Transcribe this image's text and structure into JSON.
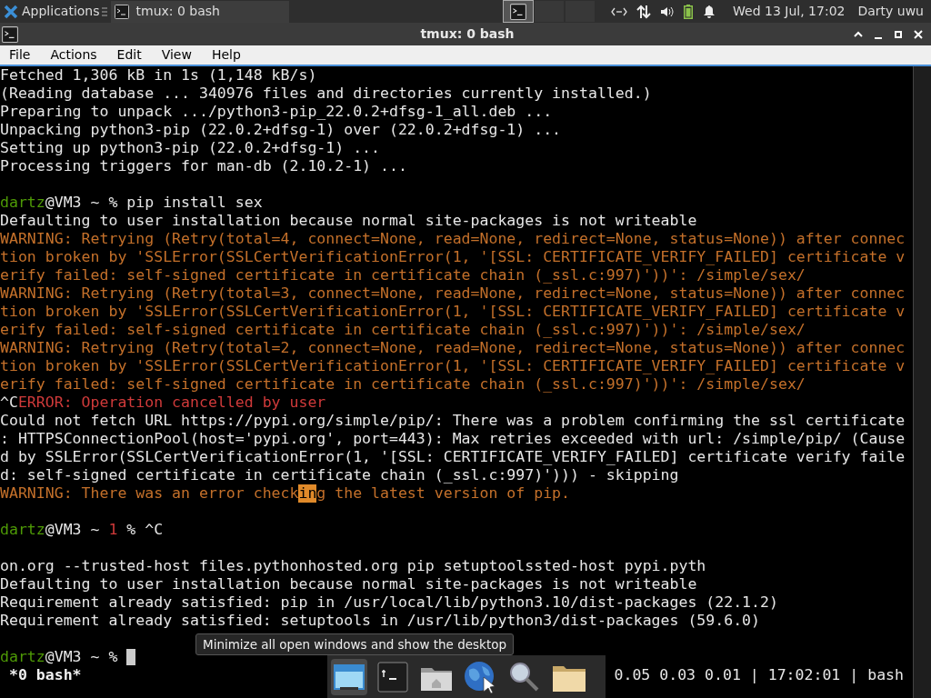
{
  "panel": {
    "apps_label": "Applications",
    "task": {
      "title": "tmux: 0 bash",
      "selected": true
    },
    "workspaces": [
      {
        "selected": true
      },
      {
        "selected": false
      },
      {
        "selected": false
      }
    ],
    "clock": "Wed 13 Jul, 17:02",
    "user": "Darty uwu"
  },
  "window": {
    "title": "tmux: 0 bash",
    "menu": [
      "File",
      "Actions",
      "Edit",
      "View",
      "Help"
    ]
  },
  "terminal": {
    "lines": [
      {
        "segments": [
          {
            "kind": "text",
            "text": "Fetched 1,306 kB in 1s (1,148 kB/s)"
          }
        ]
      },
      {
        "segments": [
          {
            "kind": "text",
            "text": "(Reading database ... 340976 files and directories currently installed.)"
          }
        ]
      },
      {
        "segments": [
          {
            "kind": "text",
            "text": "Preparing to unpack .../python3-pip_22.0.2+dfsg-1_all.deb ..."
          }
        ]
      },
      {
        "segments": [
          {
            "kind": "text",
            "text": "Unpacking python3-pip (22.0.2+dfsg-1) over (22.0.2+dfsg-1) ..."
          }
        ]
      },
      {
        "segments": [
          {
            "kind": "text",
            "text": "Setting up python3-pip (22.0.2+dfsg-1) ..."
          }
        ]
      },
      {
        "segments": [
          {
            "kind": "text",
            "text": "Processing triggers for man-db (2.10.2-1) ..."
          }
        ]
      },
      {
        "kind": "blank"
      },
      {
        "segments": [
          {
            "kind": "user",
            "text": "dartz"
          },
          {
            "kind": "text",
            "text": "@VM3 ~ % pip install sex"
          }
        ]
      },
      {
        "segments": [
          {
            "kind": "text",
            "text": "Defaulting to user installation because normal site-packages is not writeable"
          }
        ]
      },
      {
        "segments": [
          {
            "kind": "warning",
            "text": "WARNING: Retrying (Retry(total=4, connect=None, read=None, redirect=None, status=None)) after connec"
          }
        ]
      },
      {
        "segments": [
          {
            "kind": "warning",
            "text": "tion broken by 'SSLError(SSLCertVerificationError(1, '[SSL: CERTIFICATE_VERIFY_FAILED] certificate v"
          }
        ]
      },
      {
        "segments": [
          {
            "kind": "warning",
            "text": "erify failed: self-signed certificate in certificate chain (_ssl.c:997)'))': /simple/sex/"
          }
        ]
      },
      {
        "segments": [
          {
            "kind": "warning",
            "text": "WARNING: Retrying (Retry(total=3, connect=None, read=None, redirect=None, status=None)) after connec"
          }
        ]
      },
      {
        "segments": [
          {
            "kind": "warning",
            "text": "tion broken by 'SSLError(SSLCertVerificationError(1, '[SSL: CERTIFICATE_VERIFY_FAILED] certificate v"
          }
        ]
      },
      {
        "segments": [
          {
            "kind": "warning",
            "text": "erify failed: self-signed certificate in certificate chain (_ssl.c:997)'))': /simple/sex/"
          }
        ]
      },
      {
        "segments": [
          {
            "kind": "warning",
            "text": "WARNING: Retrying (Retry(total=2, connect=None, read=None, redirect=None, status=None)) after connec"
          }
        ]
      },
      {
        "segments": [
          {
            "kind": "warning",
            "text": "tion broken by 'SSLError(SSLCertVerificationError(1, '[SSL: CERTIFICATE_VERIFY_FAILED] certificate v"
          }
        ]
      },
      {
        "segments": [
          {
            "kind": "warning",
            "text": "erify failed: self-signed certificate in certificate chain (_ssl.c:997)'))': /simple/sex/"
          }
        ]
      },
      {
        "segments": [
          {
            "kind": "text",
            "text": "^C"
          },
          {
            "kind": "error",
            "text": "ERROR: Operation cancelled by user"
          }
        ]
      },
      {
        "segments": [
          {
            "kind": "text",
            "text": "Could not fetch URL https://pypi.org/simple/pip/: There was a problem confirming the ssl certificate"
          }
        ]
      },
      {
        "segments": [
          {
            "kind": "text",
            "text": ": HTTPSConnectionPool(host='pypi.org', port=443): Max retries exceeded with url: /simple/pip/ (Cause"
          }
        ]
      },
      {
        "segments": [
          {
            "kind": "text",
            "text": "d by SSLError(SSLCertVerificationError(1, '[SSL: CERTIFICATE_VERIFY_FAILED] certificate verify faile"
          }
        ]
      },
      {
        "segments": [
          {
            "kind": "text",
            "text": "d: self-signed certificate in certificate chain (_ssl.c:997)'))) - skipping"
          }
        ]
      },
      {
        "segments": [
          {
            "kind": "warning",
            "text": "WARNING: There was an error check"
          },
          {
            "kind": "selection",
            "text": "in"
          },
          {
            "kind": "warning",
            "text": "g the latest version of pip."
          }
        ]
      },
      {
        "kind": "blank"
      },
      {
        "segments": [
          {
            "kind": "user",
            "text": "dartz"
          },
          {
            "kind": "text",
            "text": "@VM3 ~ "
          },
          {
            "kind": "error",
            "text": "1"
          },
          {
            "kind": "text",
            "text": " % ^C"
          }
        ]
      },
      {
        "kind": "blank"
      },
      {
        "segments": [
          {
            "kind": "text",
            "text": "on.org --trusted-host files.pythonhosted.org pip setuptoolssted-host pypi.pyth"
          }
        ]
      },
      {
        "segments": [
          {
            "kind": "text",
            "text": "Defaulting to user installation because normal site-packages is not writeable"
          }
        ]
      },
      {
        "segments": [
          {
            "kind": "text",
            "text": "Requirement already satisfied: pip in /usr/local/lib/python3.10/dist-packages (22.1.2)"
          }
        ]
      },
      {
        "segments": [
          {
            "kind": "text",
            "text": "Requirement already satisfied: setuptools in /usr/lib/python3/dist-packages (59.6.0)"
          }
        ]
      },
      {
        "kind": "blank"
      },
      {
        "segments": [
          {
            "kind": "user",
            "text": "dartz"
          },
          {
            "kind": "text",
            "text": "@VM3 ~ % "
          }
        ],
        "cursor": true
      }
    ]
  },
  "status": {
    "left": " *0 bash*",
    "right": "0.05 0.03 0.01 | 17:02:01 | bash"
  },
  "tooltip": {
    "text": "Minimize all open windows and show the desktop"
  }
}
